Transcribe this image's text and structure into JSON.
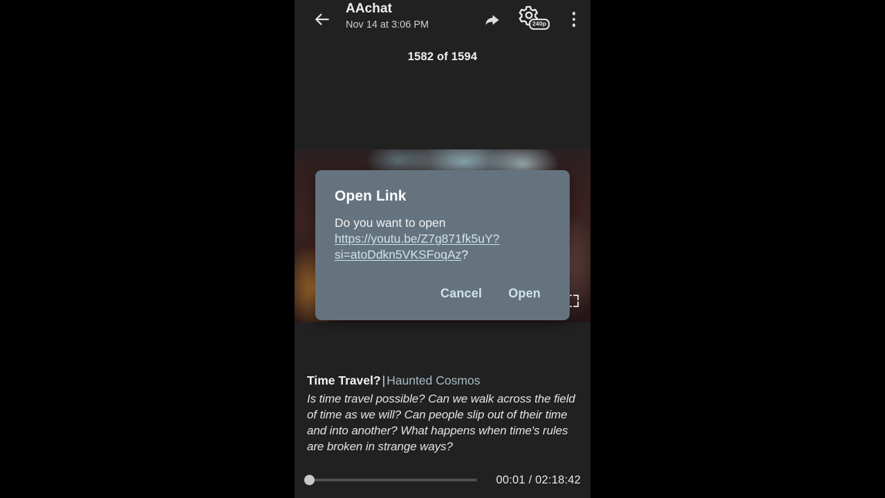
{
  "app": {
    "background_color": "#000000",
    "surface_color": "#212121"
  },
  "appbar": {
    "back_icon": "back-arrow-icon",
    "title": "AAchat",
    "subtitle": "Nov 14 at 3:06 PM",
    "share_icon": "share-arrow-icon",
    "settings_icon": "gear-icon",
    "quality_badge": "240p",
    "overflow_icon": "more-vertical-icon"
  },
  "counter": {
    "text": "1582 of 1594"
  },
  "video": {
    "fullscreen_icon": "fullscreen-icon"
  },
  "caption": {
    "title": "Time Travel?",
    "separator": "|",
    "channel": "Haunted Cosmos",
    "description": "Is time travel possible? Can we walk across the field of time as we will? Can people slip out of their time and into another? What happens when time's rules are broken in strange ways?"
  },
  "player": {
    "position": "00:01",
    "duration": "02:18:42",
    "timecode": "00:01 / 02:18:42",
    "progress_percent": 0
  },
  "dialog": {
    "title": "Open Link",
    "body_prefix": "Do you want to open ",
    "url": "https://youtu.be/Z7g871fk5uY?si=atoDdkn5VKSFoqAz",
    "body_suffix": "?",
    "cancel_label": "Cancel",
    "open_label": "Open",
    "surface_color": "#65737e",
    "accent_color": "#cfe3ec"
  }
}
